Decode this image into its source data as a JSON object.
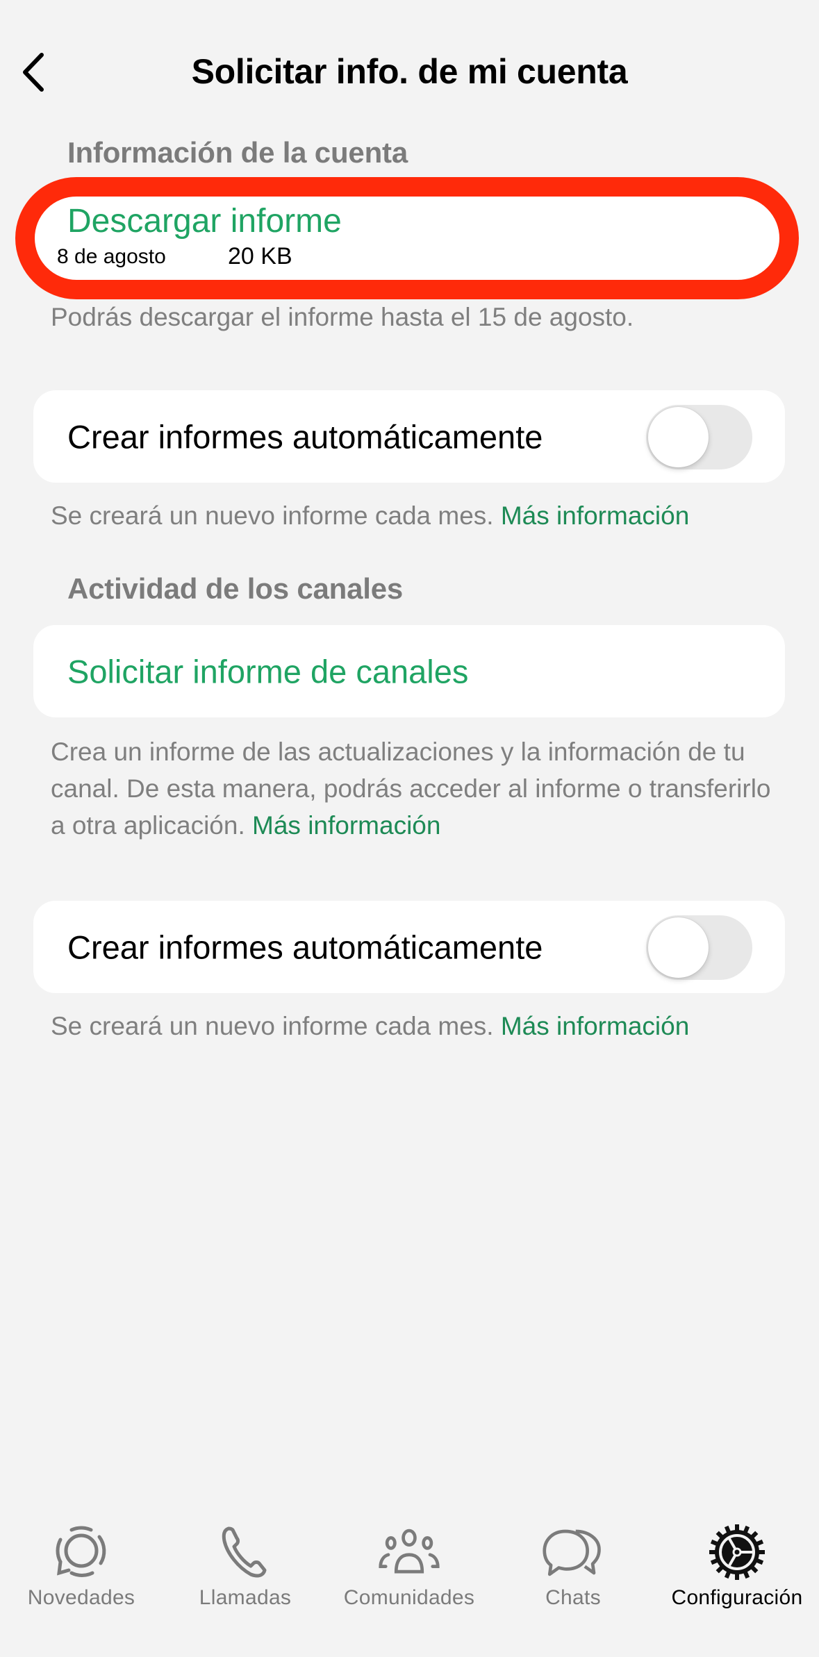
{
  "header": {
    "back_icon": "chevron-left-icon",
    "title": "Solicitar info. de mi cuenta"
  },
  "account_section": {
    "header": "Información de la cuenta",
    "download": {
      "title": "Descargar informe",
      "date": "8 de agosto",
      "size": "20 KB",
      "highlight_color": "#ff2a0a"
    },
    "footnote": "Podrás descargar el informe hasta el 15 de agosto.",
    "auto_reports": {
      "label": "Crear informes automáticamente",
      "toggle_on": false
    },
    "auto_footnote": {
      "text": "Se creará un nuevo informe cada mes. ",
      "link": "Más información"
    }
  },
  "channels_section": {
    "header": "Actividad de los canales",
    "request_label": "Solicitar informe de canales",
    "footnote": {
      "text": "Crea un informe de las actualizaciones y la información de tu canal. De esta manera, podrás acceder al informe o transferirlo a otra aplicación. ",
      "link": "Más información"
    },
    "auto_reports": {
      "label": "Crear informes automáticamente",
      "toggle_on": false
    },
    "auto_footnote": {
      "text": "Se creará un nuevo informe cada mes. ",
      "link": "Más información"
    }
  },
  "tabbar": {
    "active": "Configuración",
    "items": [
      {
        "label": "Novedades",
        "icon": "updates-icon"
      },
      {
        "label": "Llamadas",
        "icon": "phone-icon"
      },
      {
        "label": "Comunidades",
        "icon": "communities-icon"
      },
      {
        "label": "Chats",
        "icon": "chats-icon"
      },
      {
        "label": "Configuración",
        "icon": "settings-gear-icon"
      }
    ]
  },
  "colors": {
    "accent_green": "#1fa463",
    "link_green": "#1d8a55",
    "background": "#f3f3f3",
    "secondary_text": "#7f7f7f"
  }
}
